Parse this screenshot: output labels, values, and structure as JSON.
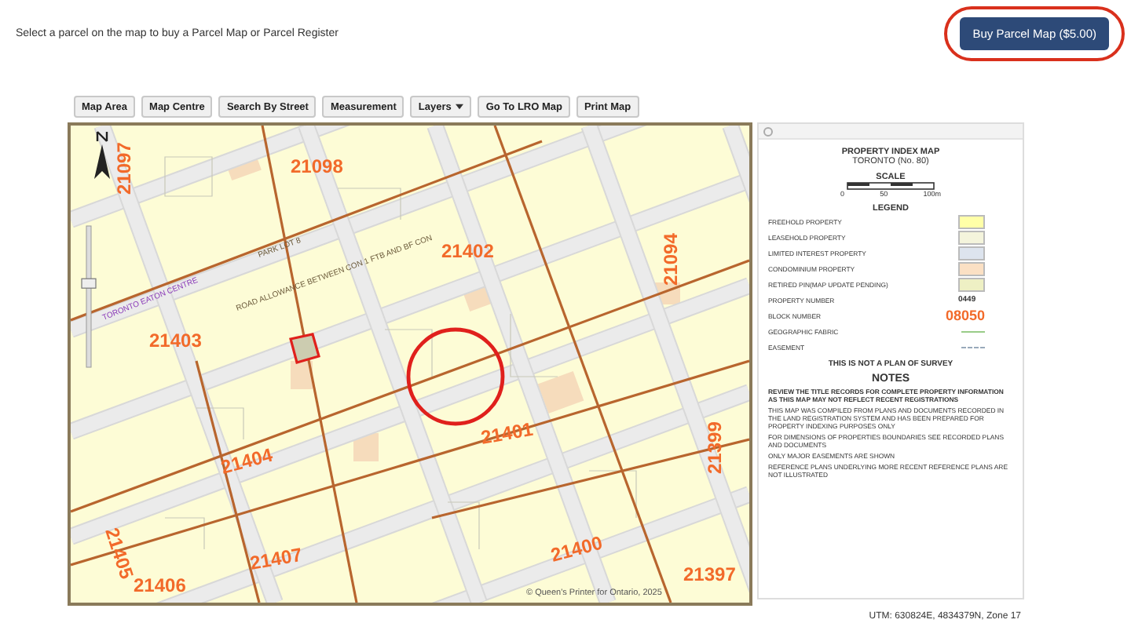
{
  "header": {
    "instruction": "Select a parcel on the map to buy a Parcel Map or Parcel Register",
    "buy_button": "Buy Parcel Map ($5.00)"
  },
  "toolbar": [
    {
      "label": "Map Area",
      "kind": "button"
    },
    {
      "label": "Map Centre",
      "kind": "button"
    },
    {
      "label": "Search By Street",
      "kind": "button"
    },
    {
      "label": "Measurement",
      "kind": "button"
    },
    {
      "label": "Layers",
      "kind": "dropdown"
    },
    {
      "label": "Go To LRO Map",
      "kind": "button"
    },
    {
      "label": "Print Map",
      "kind": "button"
    }
  ],
  "map": {
    "block_numbers": [
      "21098",
      "21097",
      "21402",
      "21094",
      "21403",
      "21401",
      "21404",
      "21405",
      "21407",
      "21406",
      "21400",
      "21399",
      "21397"
    ],
    "street_labels": [
      "TORONTO EATON CENTRE",
      "PARK LOT 8",
      "ROAD ALLOWANCE BETWEEN CON 1 FTB AND BF CON"
    ],
    "copyright": "© Queen's Printer for Ontario, 2025",
    "zoom_slider": {
      "level": 0.6
    }
  },
  "legend": {
    "title": "PROPERTY INDEX MAP",
    "subtitle": "TORONTO (No. 80)",
    "scale_title": "SCALE",
    "scale_ticks": [
      "0",
      "50",
      "100m"
    ],
    "legend_title": "LEGEND",
    "items": [
      {
        "label": "FREEHOLD PROPERTY",
        "kind": "swatch",
        "color": "#ffffa8"
      },
      {
        "label": "LEASEHOLD PROPERTY",
        "kind": "swatch",
        "color": "#f4f4dc"
      },
      {
        "label": "LIMITED INTEREST PROPERTY",
        "kind": "swatch",
        "color": "#dde4ee"
      },
      {
        "label": "CONDOMINIUM PROPERTY",
        "kind": "swatch",
        "color": "#fbe0c4"
      },
      {
        "label": "RETIRED PIN(MAP UPDATE PENDING)",
        "kind": "swatch",
        "color": "#eef0c4"
      },
      {
        "label": "PROPERTY NUMBER",
        "kind": "text",
        "value": "0449"
      },
      {
        "label": "BLOCK NUMBER",
        "kind": "block",
        "value": "08050"
      },
      {
        "label": "GEOGRAPHIC FABRIC",
        "kind": "line",
        "color": "#99cc88"
      },
      {
        "label": "EASEMENT",
        "kind": "dashed",
        "color": "#99aabb"
      }
    ],
    "disclaimer": "THIS IS NOT A PLAN OF SURVEY",
    "notes_title": "NOTES",
    "notes": [
      {
        "text": "REVIEW THE TITLE RECORDS FOR COMPLETE PROPERTY INFORMATION AS THIS MAP MAY NOT REFLECT RECENT REGISTRATIONS",
        "bold": true
      },
      {
        "text": "THIS MAP WAS COMPILED FROM PLANS AND DOCUMENTS RECORDED IN THE LAND REGISTRATION SYSTEM AND HAS BEEN PREPARED FOR PROPERTY INDEXING PURPOSES ONLY",
        "bold": false
      },
      {
        "text": "FOR DIMENSIONS OF PROPERTIES BOUNDARIES SEE RECORDED PLANS AND DOCUMENTS",
        "bold": false
      },
      {
        "text": "ONLY MAJOR EASEMENTS ARE SHOWN",
        "bold": false
      },
      {
        "text": "REFERENCE PLANS UNDERLYING MORE RECENT REFERENCE PLANS ARE NOT ILLUSTRATED",
        "bold": false
      }
    ]
  },
  "utm": "UTM: 630824E, 4834379N, Zone 17"
}
